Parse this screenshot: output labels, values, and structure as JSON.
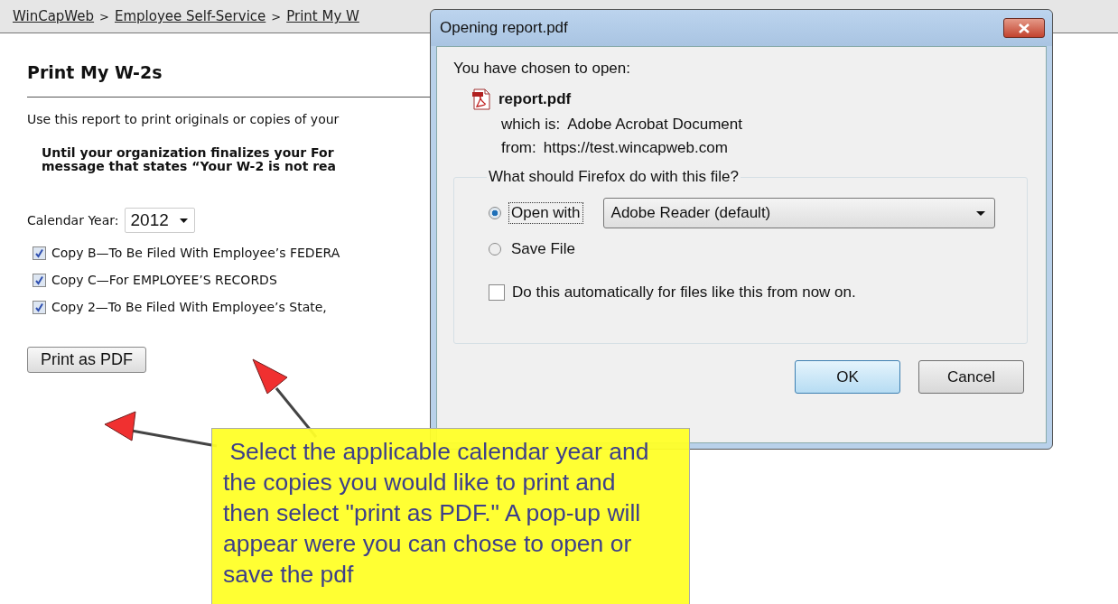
{
  "breadcrumb": {
    "separator": ">",
    "items": [
      "WinCapWeb",
      "Employee Self-Service",
      "Print My W"
    ]
  },
  "page": {
    "title": "Print My W-2s",
    "intro": "Use this report to print originals or copies of your",
    "notice_lines": [
      "Until your organization finalizes your For",
      "message that states “Your W-2 is not rea"
    ],
    "year_label": "Calendar Year:",
    "year_value": "2012",
    "copies": [
      {
        "label": "Copy B—To Be Filed With Employee’s FEDERA",
        "checked": true
      },
      {
        "label": "Copy C—For EMPLOYEE’S RECORDS",
        "checked": true
      },
      {
        "label": "Copy 2—To Be Filed With Employee’s State, ",
        "checked": true
      }
    ],
    "print_button": "Print as PDF"
  },
  "dialog": {
    "title": "Opening report.pdf",
    "chosen_label": "You have chosen to open:",
    "file_name": "report.pdf",
    "fields": [
      {
        "label": "which is:",
        "value": "Adobe Acrobat Document"
      },
      {
        "label": "from:",
        "value": "https://test.wincapweb.com"
      }
    ],
    "group_label": "What should Firefox do with this file?",
    "options": [
      {
        "label": "Open with",
        "selected": true
      },
      {
        "label": "Save File",
        "selected": false
      }
    ],
    "app_select": "Adobe Reader  (default)",
    "auto_checkbox": {
      "label": "Do this automatically for files like this from now on.",
      "checked": false
    },
    "buttons": [
      {
        "label": "OK",
        "default": true
      },
      {
        "label": "Cancel",
        "default": false
      }
    ]
  },
  "callout": {
    "text": " Select the applicable calendar year and the copies you would like to print and then select \"print as PDF.\" A pop-up will appear were you can chose to open or save the pdf"
  }
}
